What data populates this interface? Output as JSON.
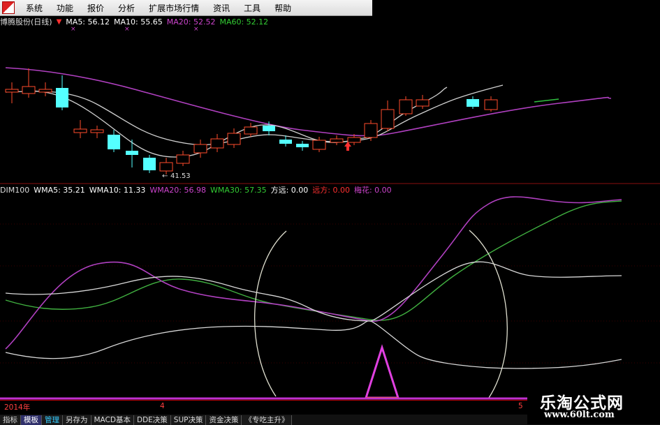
{
  "menu": [
    "系统",
    "功能",
    "报价",
    "分析",
    "扩展市场行情",
    "资讯",
    "工具",
    "帮助"
  ],
  "price_legend": {
    "stock": "博腾股份(日线)",
    "ma5": {
      "label": "MA5: 56.12",
      "color": "#ffffff"
    },
    "ma10": {
      "label": "MA10: 55.65",
      "color": "#ffffff"
    },
    "ma20": {
      "label": "MA20: 52.52",
      "color": "#cc44cc"
    },
    "ma60": {
      "label": "MA60: 52.12",
      "color": "#33cc33"
    }
  },
  "low_label": "41.53",
  "indicator_legend": {
    "name": "DIM100",
    "wma5": {
      "label": "WMA5: 35.21",
      "color": "#ffffff"
    },
    "wma10": {
      "label": "WMA10: 11.33",
      "color": "#ffffff"
    },
    "wma20": {
      "label": "WMA20: 56.98",
      "color": "#cc44cc"
    },
    "wma30": {
      "label": "WMA30: 57.35",
      "color": "#33cc33"
    },
    "fangyuan": {
      "label": "方远: 0.00",
      "color": "#ffffff"
    },
    "yuanfang": {
      "label": "远方: 0.00",
      "color": "#ff3030"
    },
    "meihua": {
      "label": "梅花: 0.00",
      "color": "#cc44cc"
    }
  },
  "time_axis": [
    {
      "label": "2014年"
    },
    {
      "label": "4"
    },
    {
      "label": "5"
    }
  ],
  "bottom_tabs": [
    {
      "label": "指标",
      "active": false
    },
    {
      "label": "模板",
      "active": true
    },
    {
      "label": "管理",
      "active": false,
      "hl": true
    },
    {
      "label": "另存为",
      "active": false
    },
    {
      "label": "MACD基本",
      "active": false
    },
    {
      "label": "DDE决策",
      "active": false
    },
    {
      "label": "SUP决策",
      "active": false
    },
    {
      "label": "资金决策",
      "active": false
    },
    {
      "label": "《专吃主升》",
      "active": false
    }
  ],
  "watermark": {
    "title": "乐淘公式网",
    "url": "www.60lt.com"
  },
  "colors": {
    "up": "#ff4b2b",
    "down": "#54ffff",
    "ma_white": "#e6e6e6",
    "ma_magenta": "#b040c0",
    "ma_green": "#30c040"
  }
}
